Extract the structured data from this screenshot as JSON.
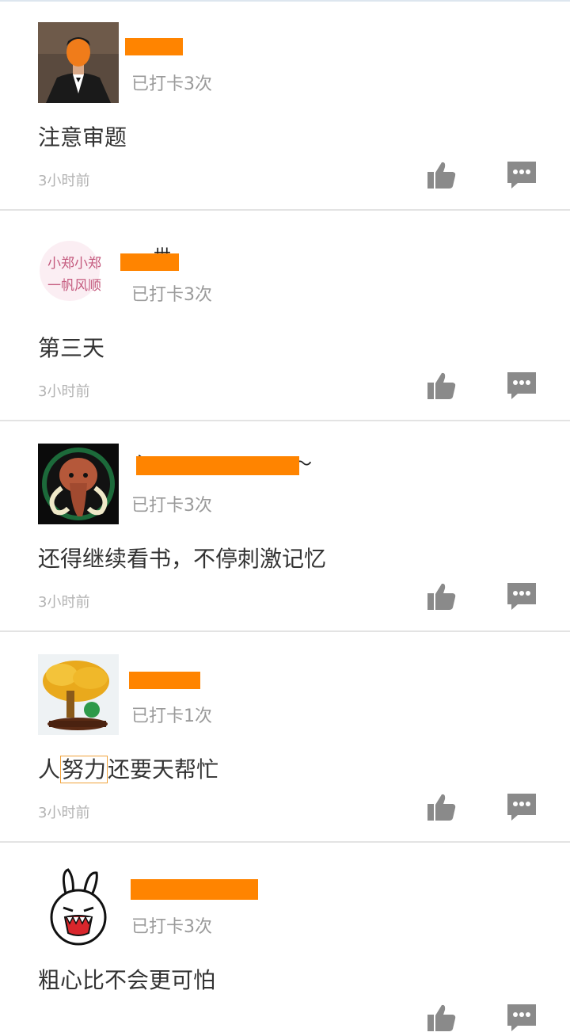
{
  "posts": [
    {
      "checkin": "已打卡3次",
      "content": "注意审题",
      "time": "3小时前",
      "avatar_icon": "person-suit-photo"
    },
    {
      "checkin": "已打卡3次",
      "content": "第三天",
      "time": "3小时前",
      "avatar_icon": "calligraphy-photo"
    },
    {
      "checkin": "已打卡3次",
      "content": "还得继续看书，不停刺激记忆",
      "time": "3小时前",
      "avatar_icon": "mammoth-photo"
    },
    {
      "checkin": "已打卡1次",
      "content_prefix": "人",
      "content_highlight": "努力",
      "content_suffix": "还要天帮忙",
      "time": "3小时前",
      "avatar_icon": "golden-tree-photo"
    },
    {
      "checkin": "已打卡3次",
      "content": "粗心比不会更可怕",
      "time": "",
      "avatar_icon": "cartoon-rabbit"
    }
  ],
  "avatar2_text": {
    "line1": "小郑小郑",
    "line2": "一帆风顺"
  },
  "colors": {
    "mask": "#ff8400",
    "muted": "#9a9a9a",
    "icon": "#8a8a8a",
    "divider": "#e3e3e3",
    "highlight": "#f0a23a"
  }
}
